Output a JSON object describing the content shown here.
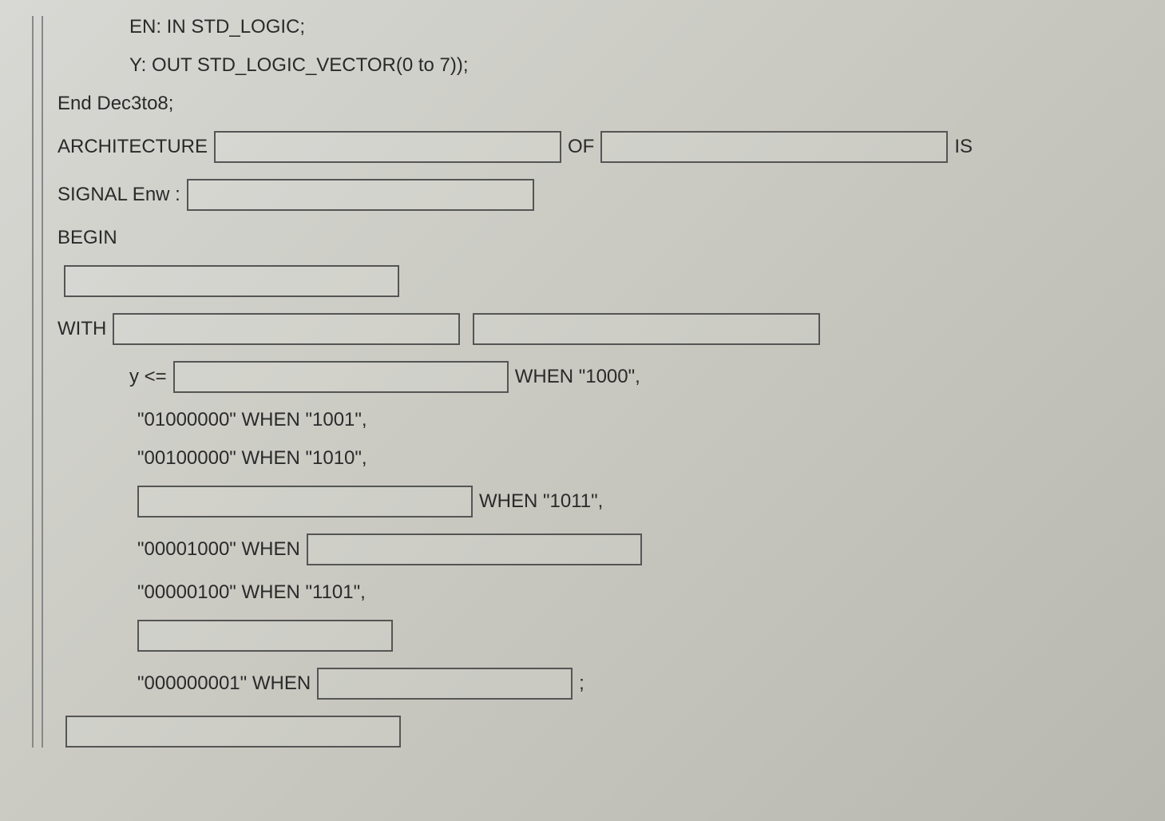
{
  "line1": "EN: IN STD_LOGIC;",
  "line2": "Y: OUT STD_LOGIC_VECTOR(0 to 7));",
  "line3": "End Dec3to8;",
  "line4_arch": "ARCHITECTURE",
  "line4_of": "OF",
  "line4_is": "IS",
  "line5": "SIGNAL Enw :",
  "line6": "BEGIN",
  "line7_with": "WITH",
  "line8_y": "y <=",
  "line8_when": "WHEN \"1000\",",
  "line9": "\"01000000\" WHEN \"1001\",",
  "line10": "\"00100000\" WHEN \"1010\",",
  "line11_when": "WHEN \"1011\",",
  "line12_val": "\"00001000\" WHEN",
  "line13": "\"00000100\" WHEN \"1101\",",
  "line14_val": "\"000000001\" WHEN",
  "line14_semi": ";"
}
